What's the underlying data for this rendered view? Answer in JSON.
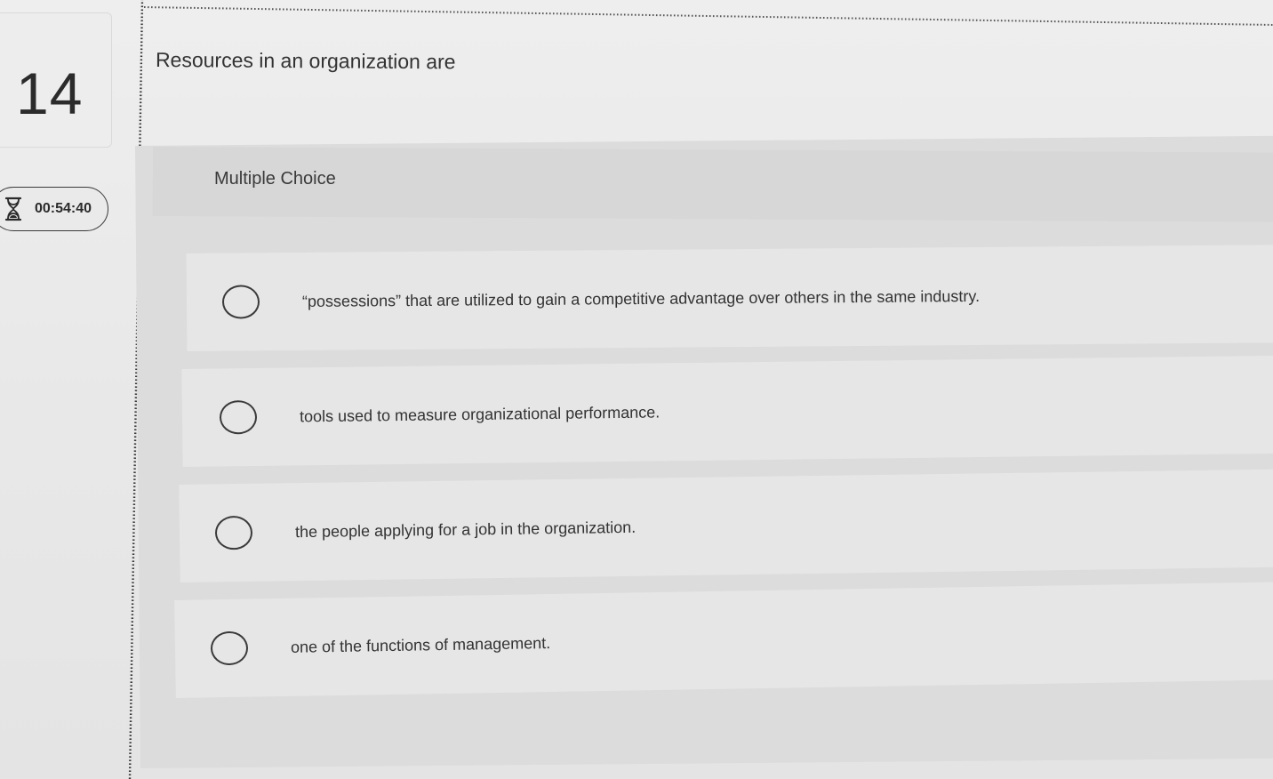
{
  "question": {
    "number": "14",
    "timer": "00:54:40",
    "prompt": "Resources in an organization are",
    "type_label": "Multiple Choice",
    "options": [
      {
        "label": "“possessions” that are utilized to gain a competitive advantage over others in the same industry."
      },
      {
        "label": "tools used to measure organizational performance."
      },
      {
        "label": "the people applying for a job in the organization."
      },
      {
        "label": "one of the functions of management."
      }
    ]
  },
  "icons": {
    "timer": "hourglass-icon",
    "option": "radio-circle-icon"
  }
}
